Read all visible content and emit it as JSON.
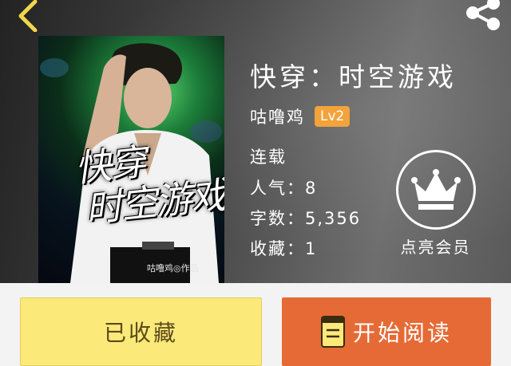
{
  "book": {
    "title": "快穿：时空游戏",
    "author": "咕噜鸡",
    "level": "Lv2",
    "status": "连载",
    "popularity_label": "人气：",
    "popularity_value": "8",
    "word_count_label": "字数：",
    "word_count_value": "5,356",
    "favorites_label": "收藏：",
    "favorites_value": "1"
  },
  "cover": {
    "title_line1": "快穿",
    "title_line2": "时空游戏",
    "author_credit": "咕噜鸡◎作品"
  },
  "vip": {
    "label": "点亮会员",
    "icon": "crown-icon"
  },
  "actions": {
    "favorite_label": "已收藏",
    "read_label": "开始阅读",
    "read_icon": "book-icon"
  },
  "header": {
    "back_icon": "back-arrow-icon",
    "share_icon": "share-icon"
  },
  "colors": {
    "accent_orange": "#e66a35",
    "favorite_yellow": "#fbe97a",
    "badge_orange": "#f2a33a",
    "header_arrow": "#f2d64b"
  }
}
